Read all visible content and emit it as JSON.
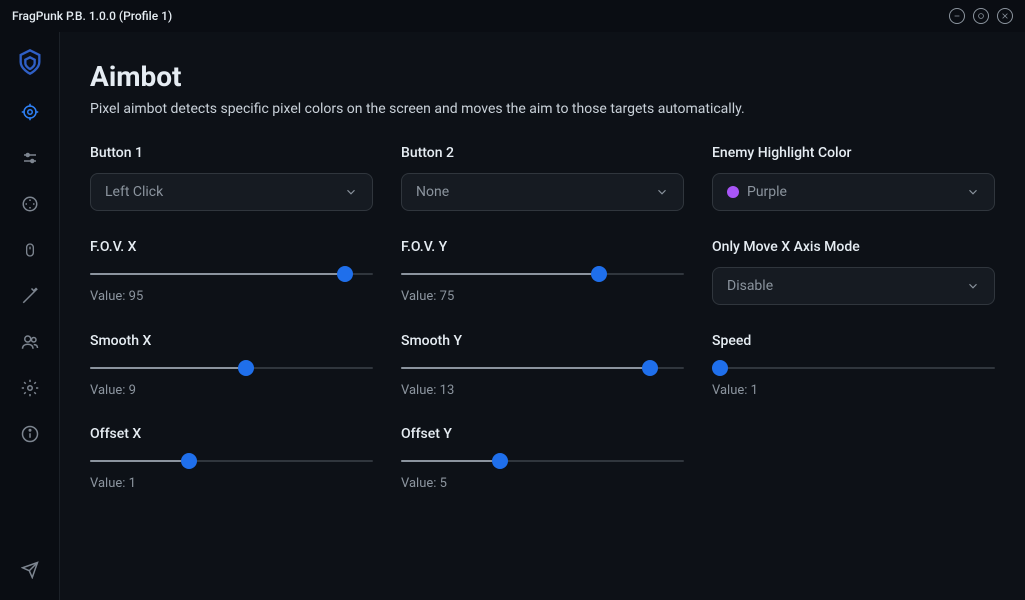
{
  "window_title": "FragPunk P.B. 1.0.0 (Profile 1)",
  "page": {
    "title": "Aimbot",
    "description": "Pixel aimbot detects specific pixel colors on the screen and moves the aim to those targets automatically."
  },
  "fields": {
    "button1": {
      "label": "Button 1",
      "value": "Left Click"
    },
    "button2": {
      "label": "Button 2",
      "value": "None"
    },
    "enemy_color": {
      "label": "Enemy Highlight Color",
      "value": "Purple",
      "swatch": "#a855f7"
    },
    "fov_x": {
      "label": "F.O.V. X",
      "value": 95,
      "pct": 90,
      "display": "Value: 95"
    },
    "fov_y": {
      "label": "F.O.V. Y",
      "value": 75,
      "pct": 70,
      "display": "Value: 75"
    },
    "only_x": {
      "label": "Only Move X Axis Mode",
      "value": "Disable"
    },
    "smooth_x": {
      "label": "Smooth X",
      "value": 9,
      "pct": 55,
      "display": "Value: 9"
    },
    "smooth_y": {
      "label": "Smooth Y",
      "value": 13,
      "pct": 88,
      "display": "Value: 13"
    },
    "speed": {
      "label": "Speed",
      "value": 1,
      "pct": 3,
      "display": "Value: 1"
    },
    "offset_x": {
      "label": "Offset X",
      "value": 1,
      "pct": 35,
      "display": "Value: 1"
    },
    "offset_y": {
      "label": "Offset Y",
      "value": 5,
      "pct": 35,
      "display": "Value: 5"
    }
  }
}
